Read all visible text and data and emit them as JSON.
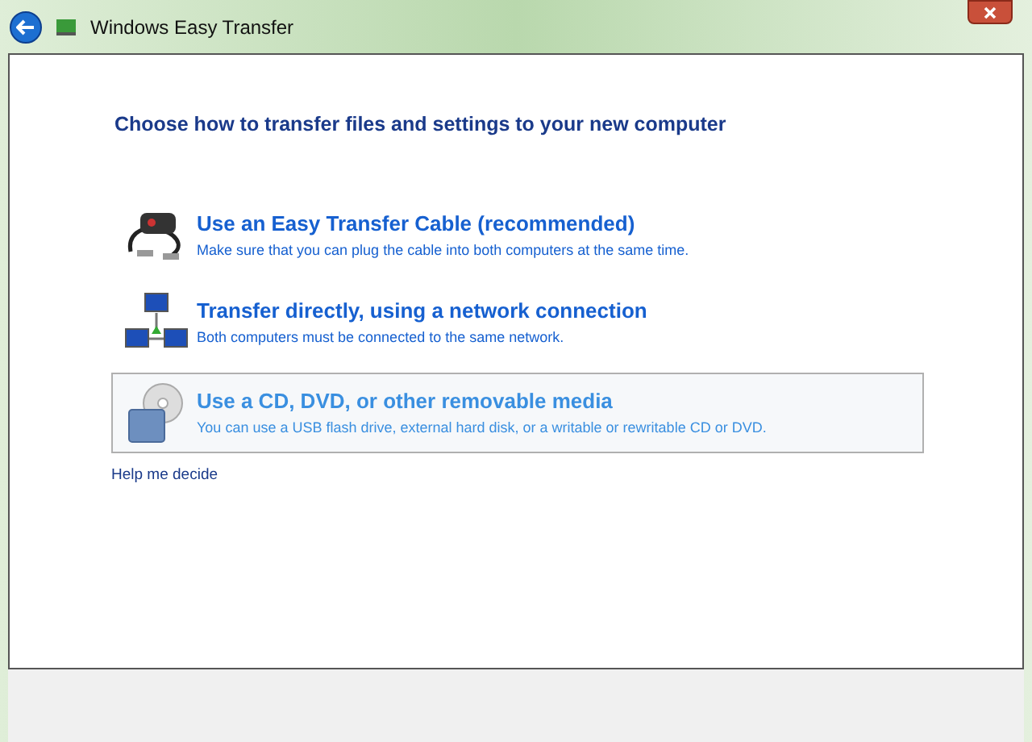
{
  "window": {
    "title": "Windows Easy Transfer"
  },
  "heading": "Choose how to transfer files and settings to your new computer",
  "options": [
    {
      "kind": "cable",
      "label": "Use an Easy Transfer Cable (recommended)",
      "description": "Make sure that you can plug the cable into both computers at the same time.",
      "selected": false
    },
    {
      "kind": "network",
      "label": "Transfer directly, using a network connection",
      "description": "Both computers must be connected to the same network.",
      "selected": false
    },
    {
      "kind": "media",
      "label": "Use a CD, DVD, or other removable media",
      "description": "You can use a USB flash drive, external hard disk, or a writable or rewritable CD or DVD.",
      "selected": true
    }
  ],
  "help_link": "Help me decide"
}
